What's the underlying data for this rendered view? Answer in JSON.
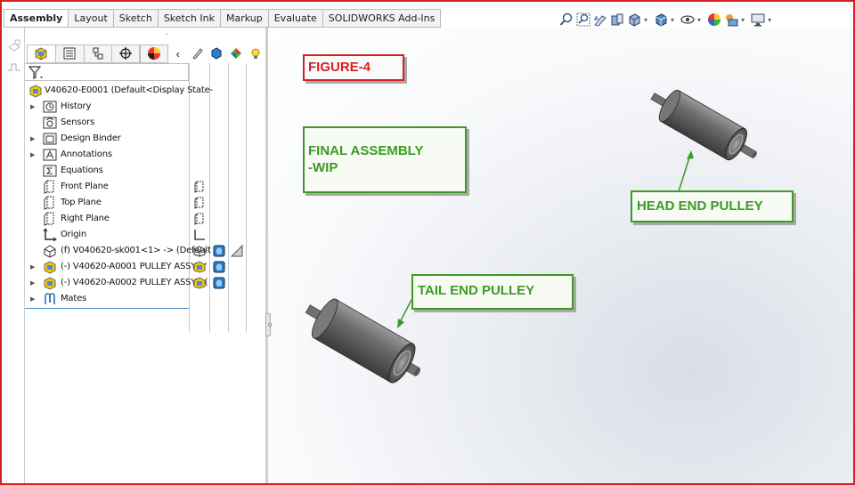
{
  "tabs": [
    "Assembly",
    "Layout",
    "Sketch",
    "Sketch Ink",
    "Markup",
    "Evaluate",
    "SOLIDWORKS Add-Ins"
  ],
  "active_tab": "Assembly",
  "heads_up_toolbar": [
    "zoom-to-fit-icon",
    "zoom-to-area-icon",
    "previous-view-icon",
    "section-view-icon",
    "view-orientation-icon",
    "display-style-icon",
    "hide-show-items-icon",
    "edit-appearance-icon",
    "apply-scene-icon",
    "view-settings-icon"
  ],
  "feature_manager": {
    "panel_tabs": [
      "featuremanager-tab",
      "propertymanager-tab",
      "configurationmanager-tab",
      "dimxpert-tab",
      "display-manager-tab"
    ],
    "root": "V40620-E0001  (Default<Display State-",
    "items": [
      {
        "label": "History",
        "icon": "history-icon",
        "expandable": true
      },
      {
        "label": "Sensors",
        "icon": "sensors-icon",
        "expandable": false
      },
      {
        "label": "Design Binder",
        "icon": "design-binder-icon",
        "expandable": true
      },
      {
        "label": "Annotations",
        "icon": "annotations-icon",
        "expandable": true
      },
      {
        "label": "Equations",
        "icon": "equations-icon",
        "expandable": false
      },
      {
        "label": "Front Plane",
        "icon": "plane-icon",
        "expandable": false
      },
      {
        "label": "Top Plane",
        "icon": "plane-icon",
        "expandable": false
      },
      {
        "label": "Right Plane",
        "icon": "plane-icon",
        "expandable": false
      },
      {
        "label": "Origin",
        "icon": "origin-icon",
        "expandable": false
      },
      {
        "label": "(f) V040620-sk001<1> -> (Default",
        "icon": "sketch-part-icon",
        "expandable": false
      },
      {
        "label": "(-) V40620-A0001 PULLEY ASSY - '",
        "icon": "subassembly-icon",
        "expandable": true
      },
      {
        "label": "(-) V40620-A0002 PULLEY ASSY - (",
        "icon": "subassembly-icon",
        "expandable": true
      },
      {
        "label": "Mates",
        "icon": "mates-icon",
        "expandable": true
      }
    ]
  },
  "annotations": {
    "figure_label": "FIGURE-4",
    "final_assembly": "FINAL ASSEMBLY\n-WIP",
    "head_end": "HEAD END PULLEY",
    "tail_end": "TAIL END PULLEY"
  },
  "colors": {
    "callout_green": "#3c9a26",
    "figure_red": "#d42020",
    "border_red": "#d42020"
  }
}
